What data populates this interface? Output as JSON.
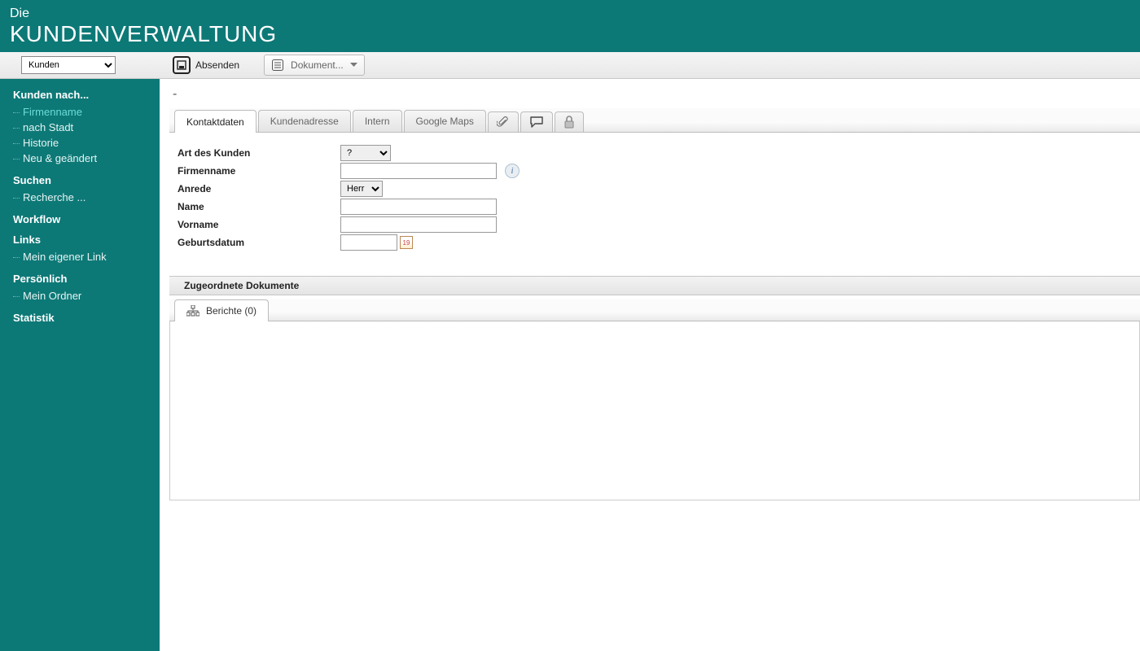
{
  "header": {
    "small": "Die",
    "title": "KUNDENVERWALTUNG"
  },
  "toolbar": {
    "selector_value": "Kunden",
    "send_label": "Absenden",
    "doc_dropdown": "Dokument..."
  },
  "sidebar": {
    "g1_title": "Kunden nach...",
    "g1_items": [
      "Firmenname",
      "nach Stadt",
      "Historie",
      "Neu & geändert"
    ],
    "g2_title": "Suchen",
    "g2_items": [
      "Recherche ..."
    ],
    "g3_title": "Workflow",
    "g4_title": "Links",
    "g4_items": [
      "Mein eigener Link"
    ],
    "g5_title": "Persönlich",
    "g5_items": [
      "Mein Ordner"
    ],
    "g6_title": "Statistik"
  },
  "breadcrumb": "-",
  "tabs": {
    "t1": "Kontaktdaten",
    "t2": "Kundenadresse",
    "t3": "Intern",
    "t4": "Google Maps"
  },
  "form": {
    "label_type": "Art des Kunden",
    "value_type": "?",
    "label_company": "Firmenname",
    "value_company": "",
    "label_salutation": "Anrede",
    "value_salutation": "Herr",
    "label_name": "Name",
    "value_name": "",
    "label_firstname": "Vorname",
    "value_firstname": "",
    "label_dob": "Geburtsdatum",
    "value_dob": ""
  },
  "docs": {
    "section_title": "Zugeordnete Dokumente",
    "reports_tab": "Berichte (0)"
  }
}
